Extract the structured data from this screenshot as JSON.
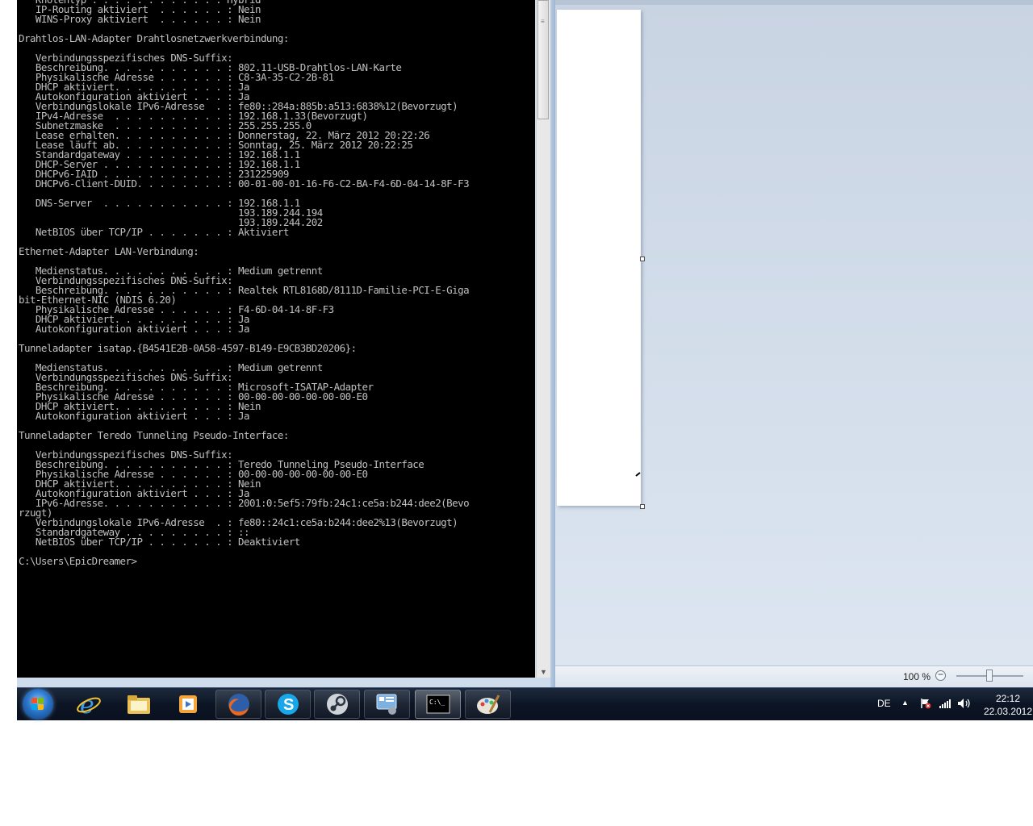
{
  "console": {
    "lines": [
      "Knotentyp . . . . . . . . . . . : Hybrid",
      "   IP-Routing aktiviert  . . . . . . : Nein",
      "   WINS-Proxy aktiviert  . . . . . . : Nein",
      "",
      "Drahtlos-LAN-Adapter Drahtlosnetzwerkverbindung:",
      "",
      "   Verbindungsspezifisches DNS-Suffix:",
      "   Beschreibung. . . . . . . . . . . : 802.11-USB-Drahtlos-LAN-Karte",
      "   Physikalische Adresse . . . . . . : C8-3A-35-C2-2B-81",
      "   DHCP aktiviert. . . . . . . . . . : Ja",
      "   Autokonfiguration aktiviert . . . : Ja",
      "   Verbindungslokale IPv6-Adresse  . : fe80::284a:885b:a513:6838%12(Bevorzugt)",
      "   IPv4-Adresse  . . . . . . . . . . : 192.168.1.33(Bevorzugt)",
      "   Subnetzmaske  . . . . . . . . . . : 255.255.255.0",
      "   Lease erhalten. . . . . . . . . . : Donnerstag, 22. März 2012 20:22:26",
      "   Lease läuft ab. . . . . . . . . . : Sonntag, 25. März 2012 20:22:25",
      "   Standardgateway . . . . . . . . . : 192.168.1.1",
      "   DHCP-Server . . . . . . . . . . . : 192.168.1.1",
      "   DHCPv6-IAID . . . . . . . . . . . : 231225909",
      "   DHCPv6-Client-DUID. . . . . . . . : 00-01-00-01-16-F6-C2-BA-F4-6D-04-14-8F-F3",
      "",
      "   DNS-Server  . . . . . . . . . . . : 192.168.1.1",
      "                                       193.189.244.194",
      "                                       193.189.244.202",
      "   NetBIOS über TCP/IP . . . . . . . : Aktiviert",
      "",
      "Ethernet-Adapter LAN-Verbindung:",
      "",
      "   Medienstatus. . . . . . . . . . . : Medium getrennt",
      "   Verbindungsspezifisches DNS-Suffix:",
      "   Beschreibung. . . . . . . . . . . : Realtek RTL8168D/8111D-Familie-PCI-E-Giga",
      "bit-Ethernet-NIC (NDIS 6.20)",
      "   Physikalische Adresse . . . . . . : F4-6D-04-14-8F-F3",
      "   DHCP aktiviert. . . . . . . . . . : Ja",
      "   Autokonfiguration aktiviert . . . : Ja",
      "",
      "Tunneladapter isatap.{B4541E2B-0A58-4597-B149-E9CB3BD20206}:",
      "",
      "   Medienstatus. . . . . . . . . . . : Medium getrennt",
      "   Verbindungsspezifisches DNS-Suffix:",
      "   Beschreibung. . . . . . . . . . . : Microsoft-ISATAP-Adapter",
      "   Physikalische Adresse . . . . . . : 00-00-00-00-00-00-00-E0",
      "   DHCP aktiviert. . . . . . . . . . : Nein",
      "   Autokonfiguration aktiviert . . . : Ja",
      "",
      "Tunneladapter Teredo Tunneling Pseudo-Interface:",
      "",
      "   Verbindungsspezifisches DNS-Suffix:",
      "   Beschreibung. . . . . . . . . . . : Teredo Tunneling Pseudo-Interface",
      "   Physikalische Adresse . . . . . . : 00-00-00-00-00-00-00-E0",
      "   DHCP aktiviert. . . . . . . . . . : Nein",
      "   Autokonfiguration aktiviert . . . : Ja",
      "   IPv6-Adresse. . . . . . . . . . . : 2001:0:5ef5:79fb:24c1:ce5a:b244:dee2(Bevo",
      "rzugt)",
      "   Verbindungslokale IPv6-Adresse  . : fe80::24c1:ce5a:b244:dee2%13(Bevorzugt)",
      "   Standardgateway . . . . . . . . . : ::",
      "   NetBIOS über TCP/IP . . . . . . . : Deaktiviert",
      "",
      "C:\\Users\\EpicDreamer>"
    ]
  },
  "paint": {
    "zoom_label": "100 %",
    "zoom_level_percent": 100,
    "zoom_minus_glyph": "−"
  },
  "taskbar": {
    "items": [
      {
        "name": "internet-explorer-icon",
        "state": "pinned"
      },
      {
        "name": "file-explorer-icon",
        "state": "pinned"
      },
      {
        "name": "media-player-icon",
        "state": "pinned"
      },
      {
        "name": "firefox-icon",
        "state": "open"
      },
      {
        "name": "skype-icon",
        "state": "open"
      },
      {
        "name": "steam-icon",
        "state": "open"
      },
      {
        "name": "control-panel-icon",
        "state": "open"
      },
      {
        "name": "command-prompt-icon",
        "state": "active"
      },
      {
        "name": "paint-icon",
        "state": "open"
      }
    ],
    "tray": {
      "language": "DE",
      "arrow": "▲",
      "time": "22:12",
      "date": "22.03.2012"
    }
  },
  "colors": {
    "console_text": "#c0c0c0",
    "console_bg": "#000000",
    "taskbar_bg": "#0c1524"
  }
}
